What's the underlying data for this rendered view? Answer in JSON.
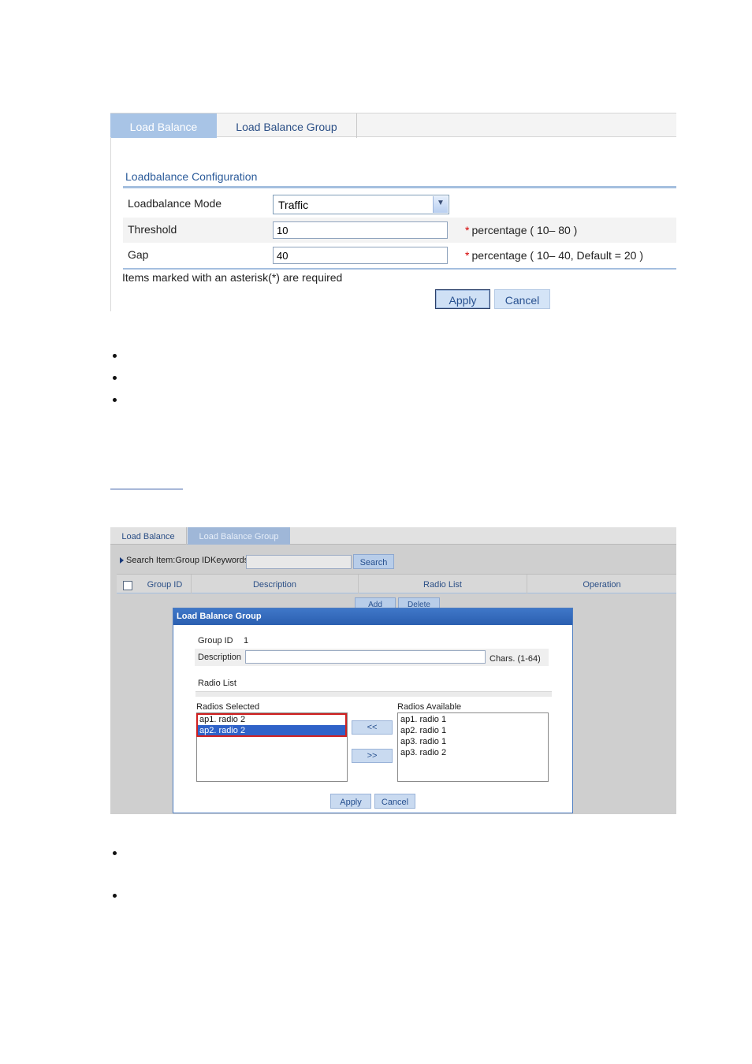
{
  "panel1": {
    "tabs": [
      "Load Balance",
      "Load Balance Group"
    ],
    "section_title": "Loadbalance Configuration",
    "mode_label": "Loadbalance Mode",
    "mode_value": "Traffic",
    "threshold_label": "Threshold",
    "threshold_value": "10",
    "threshold_hint": "percentage ( 10– 80 )",
    "gap_label": "Gap",
    "gap_value": "40",
    "gap_hint": "percentage ( 10– 40, Default = 20 )",
    "asterisk": "*",
    "required_note": "Items marked with an asterisk(*) are required",
    "apply_label": "Apply",
    "cancel_label": "Cancel"
  },
  "panel2": {
    "tabs": [
      "Load Balance",
      "Load Balance Group"
    ],
    "search_text": "Search Item:Group IDKeywords:",
    "search_button": "Search",
    "columns": [
      "Group ID",
      "Description",
      "Radio List",
      "Operation"
    ],
    "add_button": "Add",
    "delete_button": "Delete",
    "dialog": {
      "title": "Load Balance Group",
      "group_id_label": "Group ID",
      "group_id_value": "1",
      "description_label": "Description",
      "description_value": "",
      "chars_hint": "Chars. (1-64)",
      "radio_list_label": "Radio List",
      "selected_label": "Radios Selected",
      "available_label": "Radios Available",
      "radios_selected": [
        "ap1. radio 2",
        "ap2. radio 2"
      ],
      "radios_available": [
        "ap1. radio 1",
        "ap2. radio 1",
        "ap3. radio 1",
        "ap3. radio 2"
      ],
      "move_left_label": "<<",
      "move_right_label": ">>",
      "apply_label": "Apply",
      "cancel_label": "Cancel"
    }
  },
  "colors": {
    "accent": "#a8c4e6",
    "link": "#2b4f86",
    "required": "#d40000",
    "selection": "#2f62c8",
    "highlight_box": "#d02020"
  }
}
